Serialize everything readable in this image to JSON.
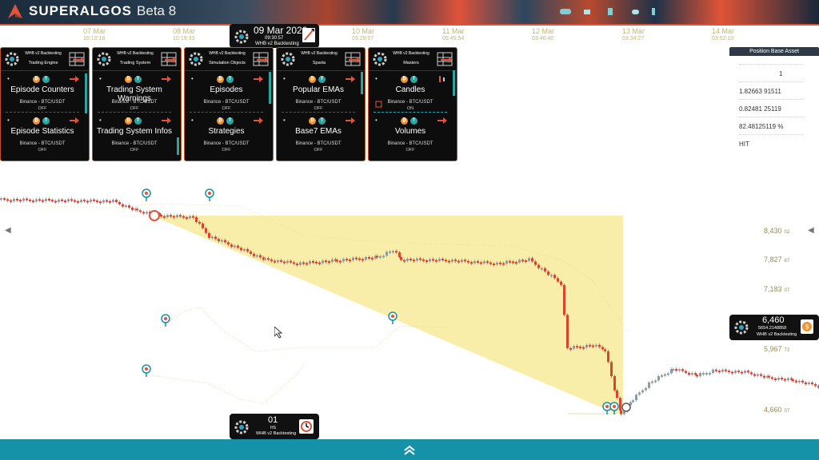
{
  "app": {
    "brand": "SUPERALGOS",
    "version": "Beta 8"
  },
  "timeline": [
    {
      "date": "07 Mar",
      "time": "10:10:18"
    },
    {
      "date": "08 Mar",
      "time": "10:19:33"
    },
    {
      "date": "10 Mar",
      "time": "03:28:07"
    },
    {
      "date": "11 Mar",
      "time": "05:45:54"
    },
    {
      "date": "12 Mar",
      "time": "03:46:40"
    },
    {
      "date": "13 Mar",
      "time": "03:34:27"
    },
    {
      "date": "14 Mar",
      "time": "03:52:10"
    }
  ],
  "date_panel": {
    "date": "09 Mar 2020",
    "time": "09:30:57",
    "label": "WHB v2 Backtesting"
  },
  "panels": [
    {
      "title_top": "WHB v2 Backtesting",
      "title_bottom": "Trading Engine",
      "slots": [
        {
          "name": "Episode Counters",
          "exchange": "Binance - BTC/USDT",
          "status": "OFF"
        },
        {
          "name": "Episode Statistics",
          "exchange": "Binance - BTC/USDT",
          "status": "OFF"
        }
      ]
    },
    {
      "title_top": "WHB v2 Backtesting",
      "title_bottom": "Trading System",
      "slots": [
        {
          "name": "Trading System Warnings",
          "exchange": "Binance - BTC/USDT",
          "status": "OFF"
        },
        {
          "name": "Trading System Infos",
          "exchange": "Binance - BTC/USDT",
          "status": "OFF"
        }
      ]
    },
    {
      "title_top": "WHB v2 Backtesting",
      "title_bottom": "Simulation Objects",
      "slots": [
        {
          "name": "Episodes",
          "exchange": "Binance - BTC/USDT",
          "status": "OFF"
        },
        {
          "name": "Strategies",
          "exchange": "Binance - BTC/USDT",
          "status": "OFF"
        }
      ]
    },
    {
      "title_top": "WHB v2 Backtesting",
      "title_bottom": "Sparta",
      "slots": [
        {
          "name": "Popular EMAs",
          "exchange": "Binance - BTC/USDT",
          "status": "OFF"
        },
        {
          "name": "Base7 EMAs",
          "exchange": "Binance - BTC/USDT",
          "status": "OFF"
        }
      ]
    },
    {
      "title_top": "WHB v2 Backtesting",
      "title_bottom": "Masters",
      "slots": [
        {
          "name": "Candles",
          "exchange": "Binance - BTC/USDT",
          "status": "ON"
        },
        {
          "name": "Volumes",
          "exchange": "Binance - BTC/USDT",
          "status": "OFF"
        }
      ]
    }
  ],
  "position_panel": {
    "header": "Position Base Asset",
    "values": [
      "1",
      "1.82663 91511",
      "0.82481 25119",
      "82.48125119 %",
      "HIT"
    ]
  },
  "price_labels": [
    {
      "main": "8,430",
      "small": "02"
    },
    {
      "main": "7,827",
      "small": "87"
    },
    {
      "main": "7,183",
      "small": "07"
    },
    {
      "main": "5,967",
      "small": "72"
    },
    {
      "main": "4,660",
      "small": "07"
    }
  ],
  "price_card": {
    "value": "6,460",
    "sub": "5654.2148858",
    "label": "WHB v2 Backtesting"
  },
  "bottom_card": {
    "value": "01",
    "sub": "HS",
    "label": "WHB v2 Backtesting"
  },
  "colors": {
    "accent": "#e0523a",
    "teal": "#1592a8",
    "highlight": "#f7eb9a",
    "candle_up": "#8b9ba6",
    "candle_down": "#d9432f"
  }
}
